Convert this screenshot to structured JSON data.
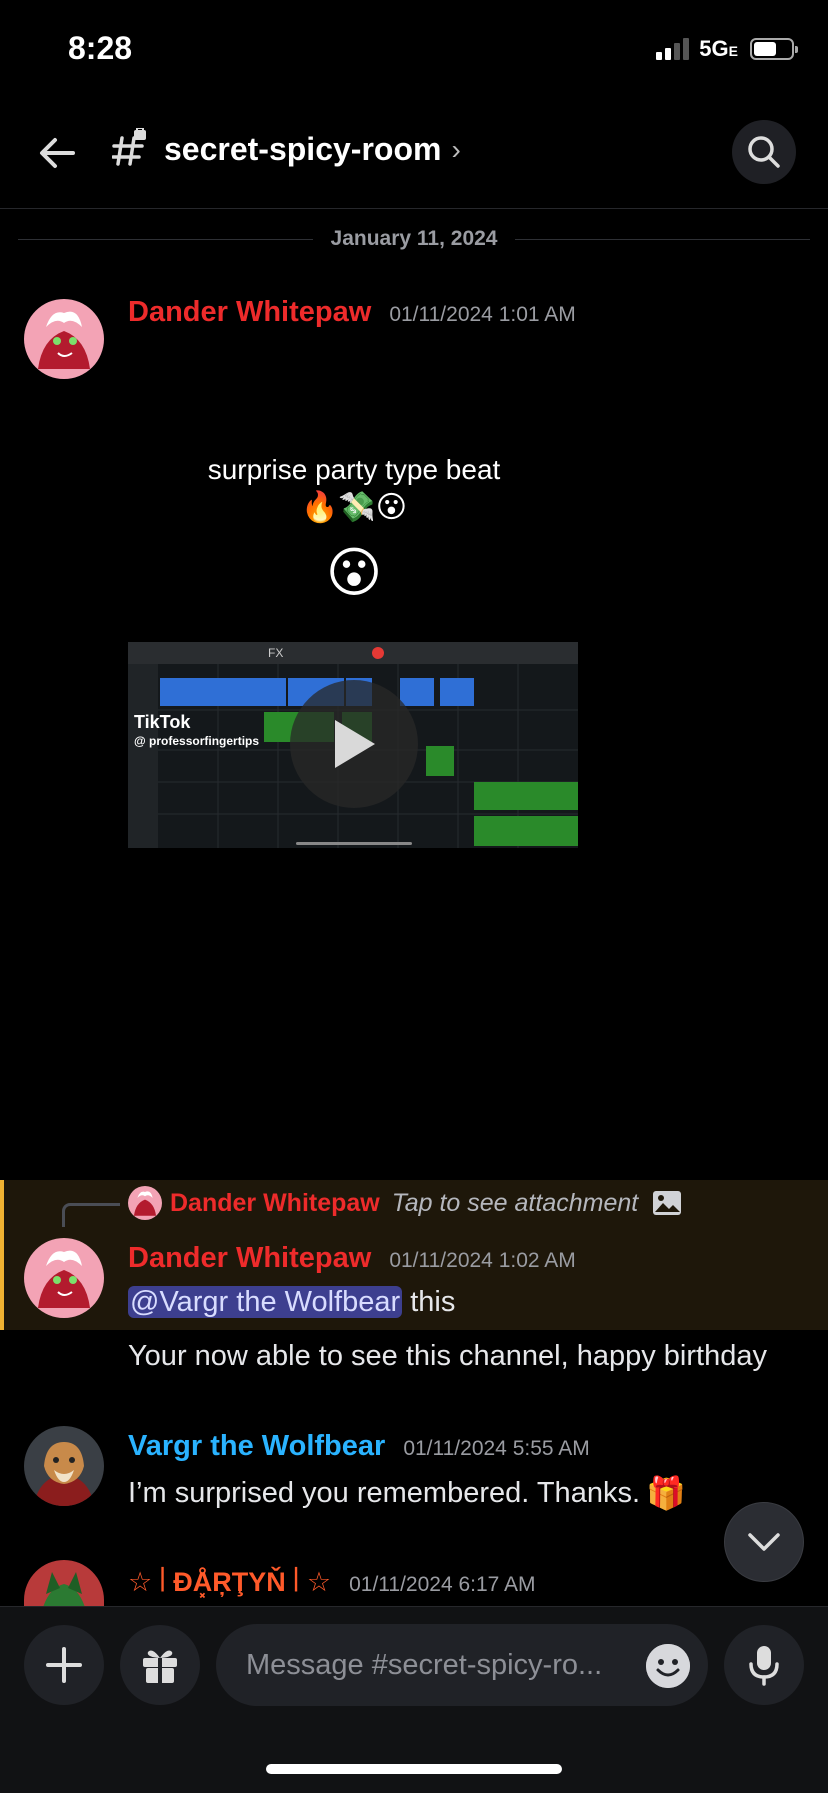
{
  "status": {
    "time": "8:28",
    "network": "5G",
    "network_suffix": "E",
    "battery_level": 0.6
  },
  "header": {
    "channel_name": "secret-spicy-room",
    "chevron": "›",
    "channel_icon": "locked-hash-icon"
  },
  "date_divider": "January 11, 2024",
  "messages": [
    {
      "author": "Dander Whitepaw",
      "timestamp": "01/11/2024 1:01 AM",
      "embed": {
        "caption": "surprise party type beat",
        "caption_emojis": "🔥💸😮",
        "emoji_large": "😮",
        "video_brand": "TikTok",
        "video_handle": "@ professorfingertips",
        "toolbar_fx": "FX"
      }
    },
    {
      "reply_to": {
        "author": "Dander Whitepaw",
        "text": "Tap to see attachment"
      },
      "author": "Dander Whitepaw",
      "timestamp": "01/11/2024 1:02 AM",
      "mention": "@Vargr the Wolfbear",
      "text_after_mention": " this",
      "text2": "Your now able to see this channel, happy birthday"
    },
    {
      "author": "Vargr the Wolfbear",
      "timestamp": "01/11/2024 5:55 AM",
      "text": "I’m surprised you remembered. Thanks.",
      "emoji": "🎁"
    },
    {
      "author": "☆꒐ĐÅ͓ŖŢYŇ꒐☆",
      "timestamp": "01/11/2024 6:17 AM"
    }
  ],
  "composer": {
    "placeholder": "Message #secret-spicy-ro..."
  },
  "colors": {
    "red_name": "#ee2b2b",
    "blue_name": "#2ab3ff",
    "reply_accent": "#f0b232",
    "mention_bg": "#3d3f8f"
  }
}
